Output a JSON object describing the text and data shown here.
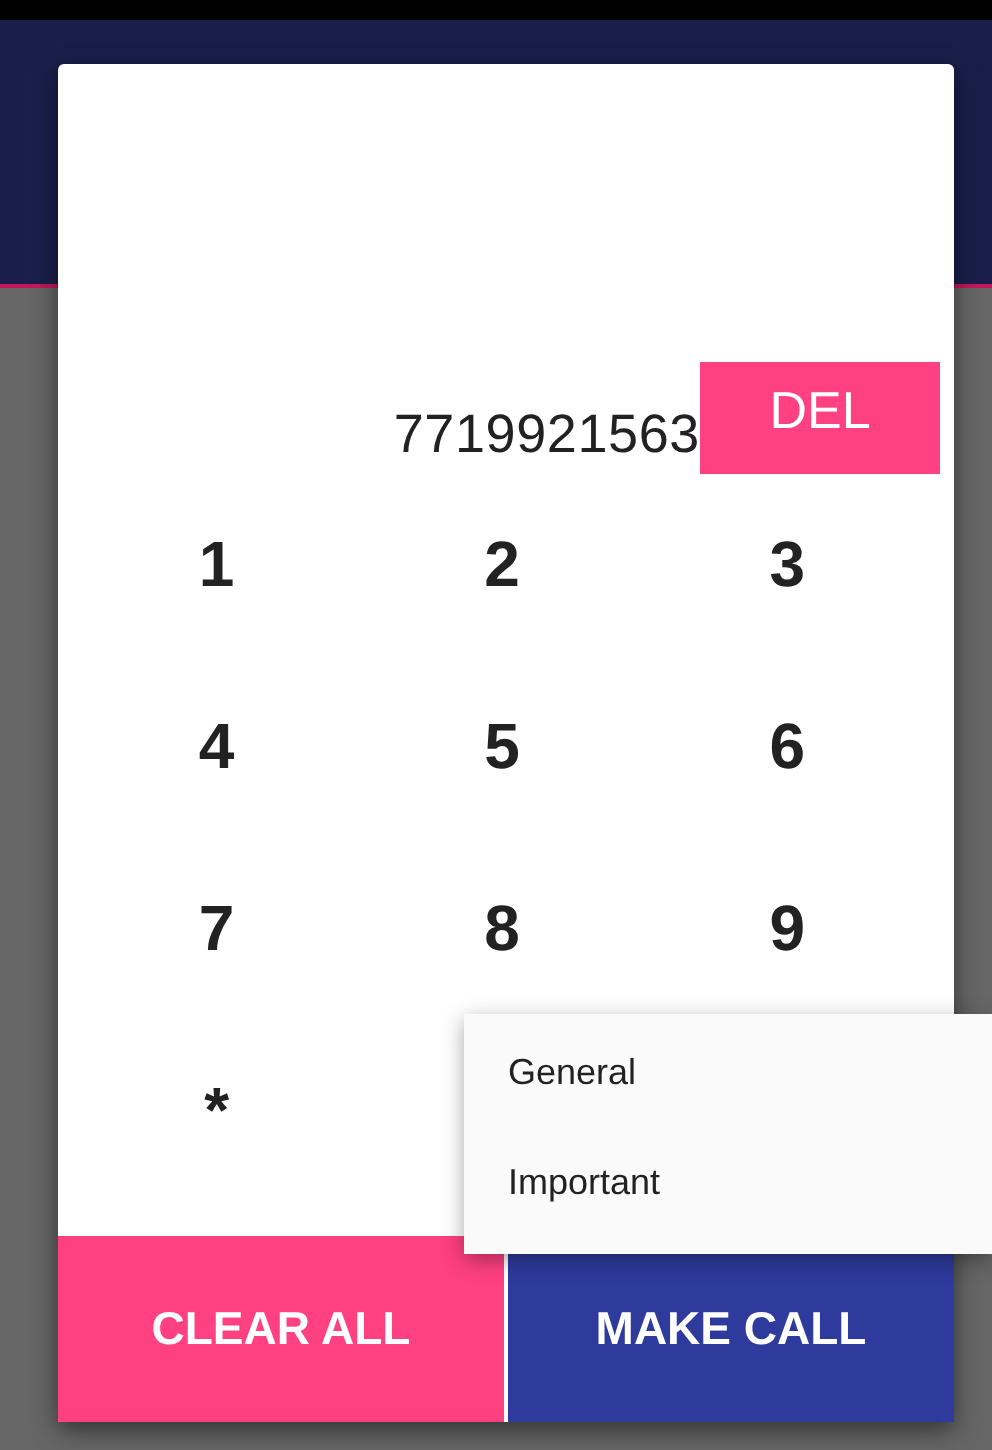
{
  "number": "7719921563",
  "delete_button": "DEL",
  "keys": [
    "1",
    "2",
    "3",
    "4",
    "5",
    "6",
    "7",
    "8",
    "9",
    "*"
  ],
  "menu": {
    "items": [
      "General",
      "Important"
    ]
  },
  "buttons": [
    {
      "label": "CLEAR ALL",
      "kind": "secondary"
    },
    {
      "label": "MAKE CALL",
      "kind": "primary"
    }
  ]
}
